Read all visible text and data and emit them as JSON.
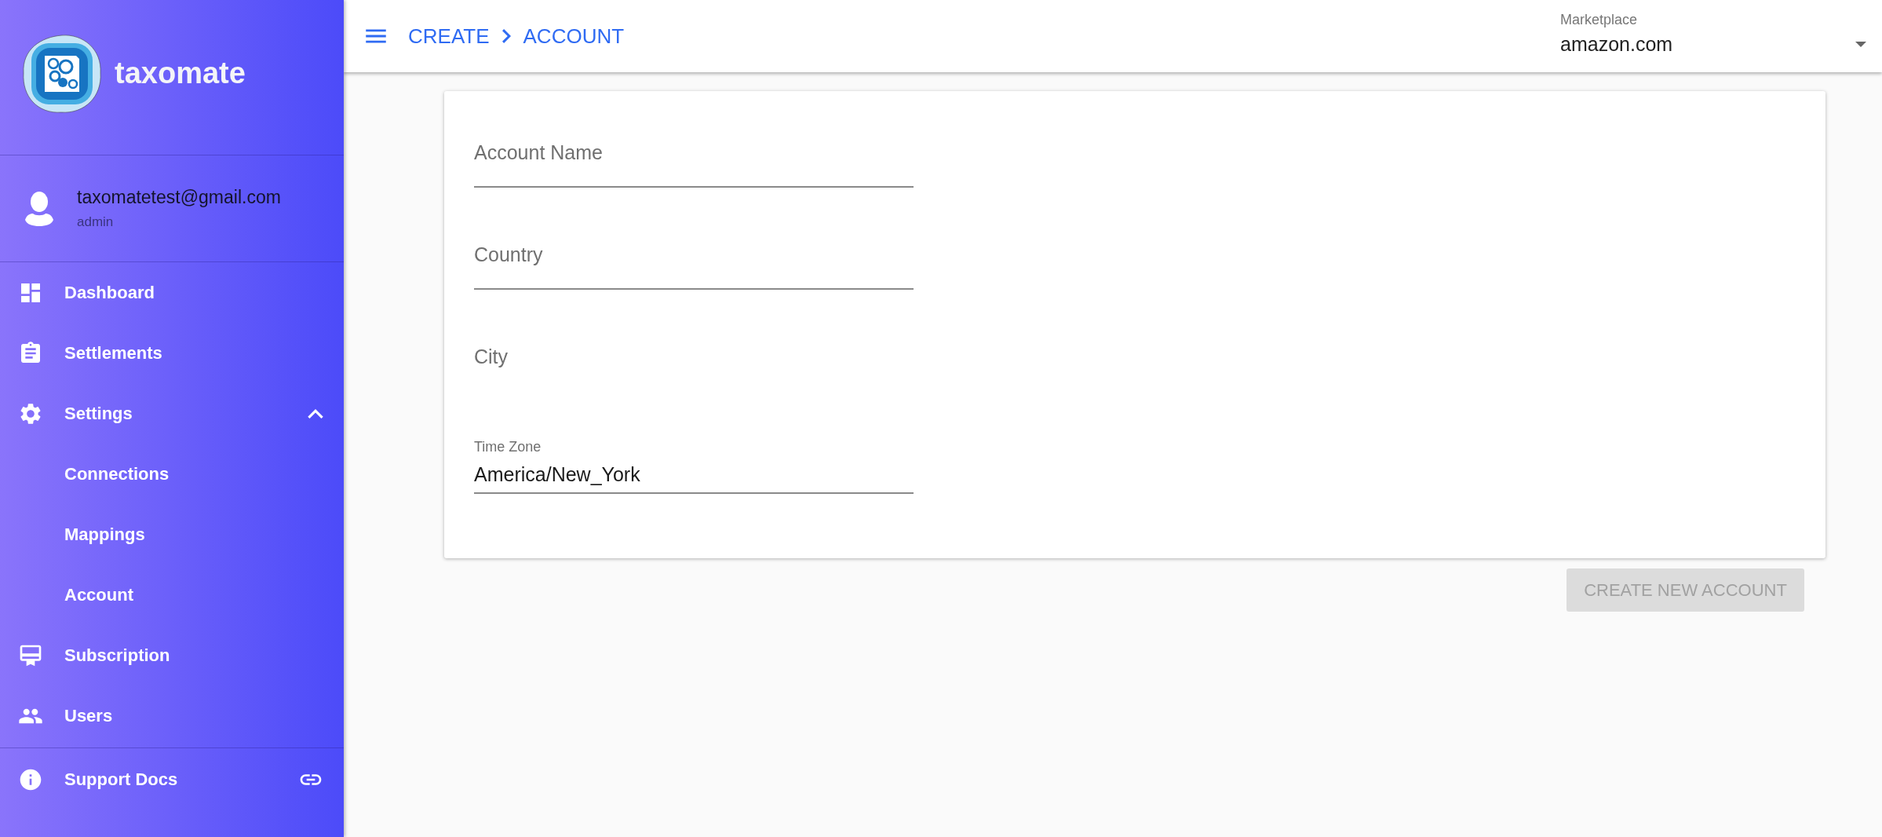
{
  "brand": {
    "name": "taxomate"
  },
  "user": {
    "email": "taxomatetest@gmail.com",
    "role": "admin"
  },
  "nav": [
    {
      "label": "Dashboard",
      "kind": "item"
    },
    {
      "label": "Settlements",
      "kind": "item"
    },
    {
      "label": "Settings",
      "kind": "group",
      "expanded": true,
      "children": [
        {
          "label": "Connections"
        },
        {
          "label": "Mappings"
        },
        {
          "label": "Account"
        }
      ]
    },
    {
      "label": "Subscription",
      "kind": "item"
    },
    {
      "label": "Users",
      "kind": "item"
    }
  ],
  "footer_nav": [
    {
      "label": "Support Docs",
      "kind": "external"
    }
  ],
  "breadcrumb": [
    "CREATE",
    "ACCOUNT"
  ],
  "marketplace": {
    "label": "Marketplace",
    "value": "amazon.com"
  },
  "form": {
    "fields": [
      {
        "kind": "text",
        "placeholder": "Account Name",
        "underlined": true
      },
      {
        "kind": "text",
        "placeholder": "Country",
        "underlined": true
      },
      {
        "kind": "text",
        "placeholder": "City",
        "underlined": false
      },
      {
        "kind": "select",
        "label": "Time Zone",
        "value": "America/New_York",
        "underlined": true
      }
    ],
    "submit": {
      "label": "CREATE NEW ACCOUNT",
      "disabled": true
    }
  }
}
